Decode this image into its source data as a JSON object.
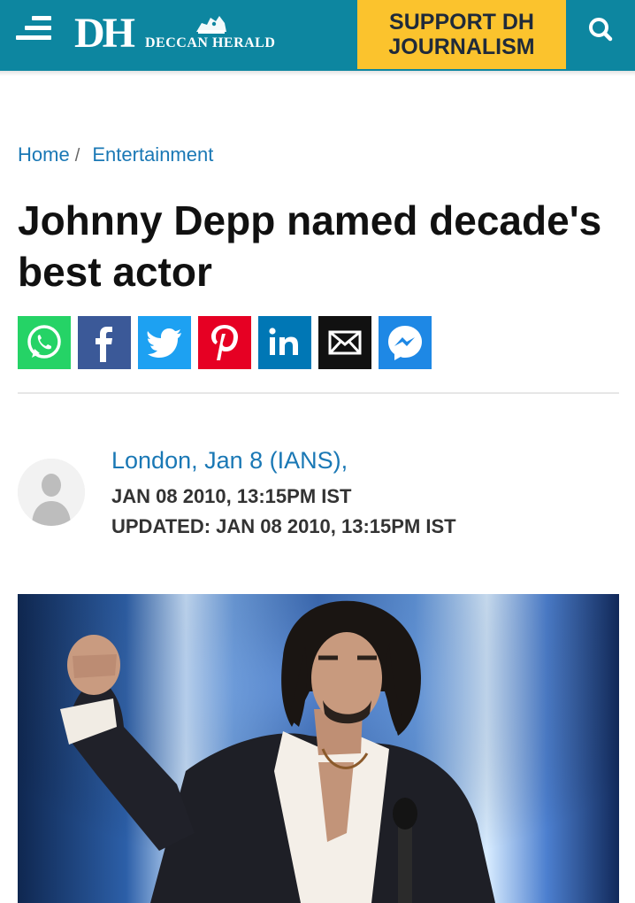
{
  "header": {
    "logo_short": "DH",
    "logo_name": "DECCAN HERALD",
    "support_label": "SUPPORT DH JOURNALISM",
    "brand_color": "#0d86a0",
    "support_color": "#fbc32d"
  },
  "breadcrumb": {
    "items": [
      "Home",
      "Entertainment"
    ],
    "separator": "/"
  },
  "article": {
    "title": "Johnny Depp named decade's best actor",
    "author": "London, Jan 8 (IANS),",
    "published": "JAN 08 2010, 13:15PM IST",
    "updated": "UPDATED: JAN 08 2010, 13:15PM IST"
  },
  "share": {
    "buttons": [
      {
        "name": "whatsapp",
        "icon": "whatsapp-icon",
        "color": "#25d366"
      },
      {
        "name": "facebook",
        "icon": "facebook-icon",
        "color": "#3b5998"
      },
      {
        "name": "twitter",
        "icon": "twitter-icon",
        "color": "#1da1f2"
      },
      {
        "name": "pinterest",
        "icon": "pinterest-icon",
        "color": "#e60023"
      },
      {
        "name": "linkedin",
        "icon": "linkedin-icon",
        "color": "#0077b5"
      },
      {
        "name": "email",
        "icon": "envelope-icon",
        "color": "#111111"
      },
      {
        "name": "messenger",
        "icon": "messenger-icon",
        "color": "#1e88e5"
      }
    ]
  }
}
